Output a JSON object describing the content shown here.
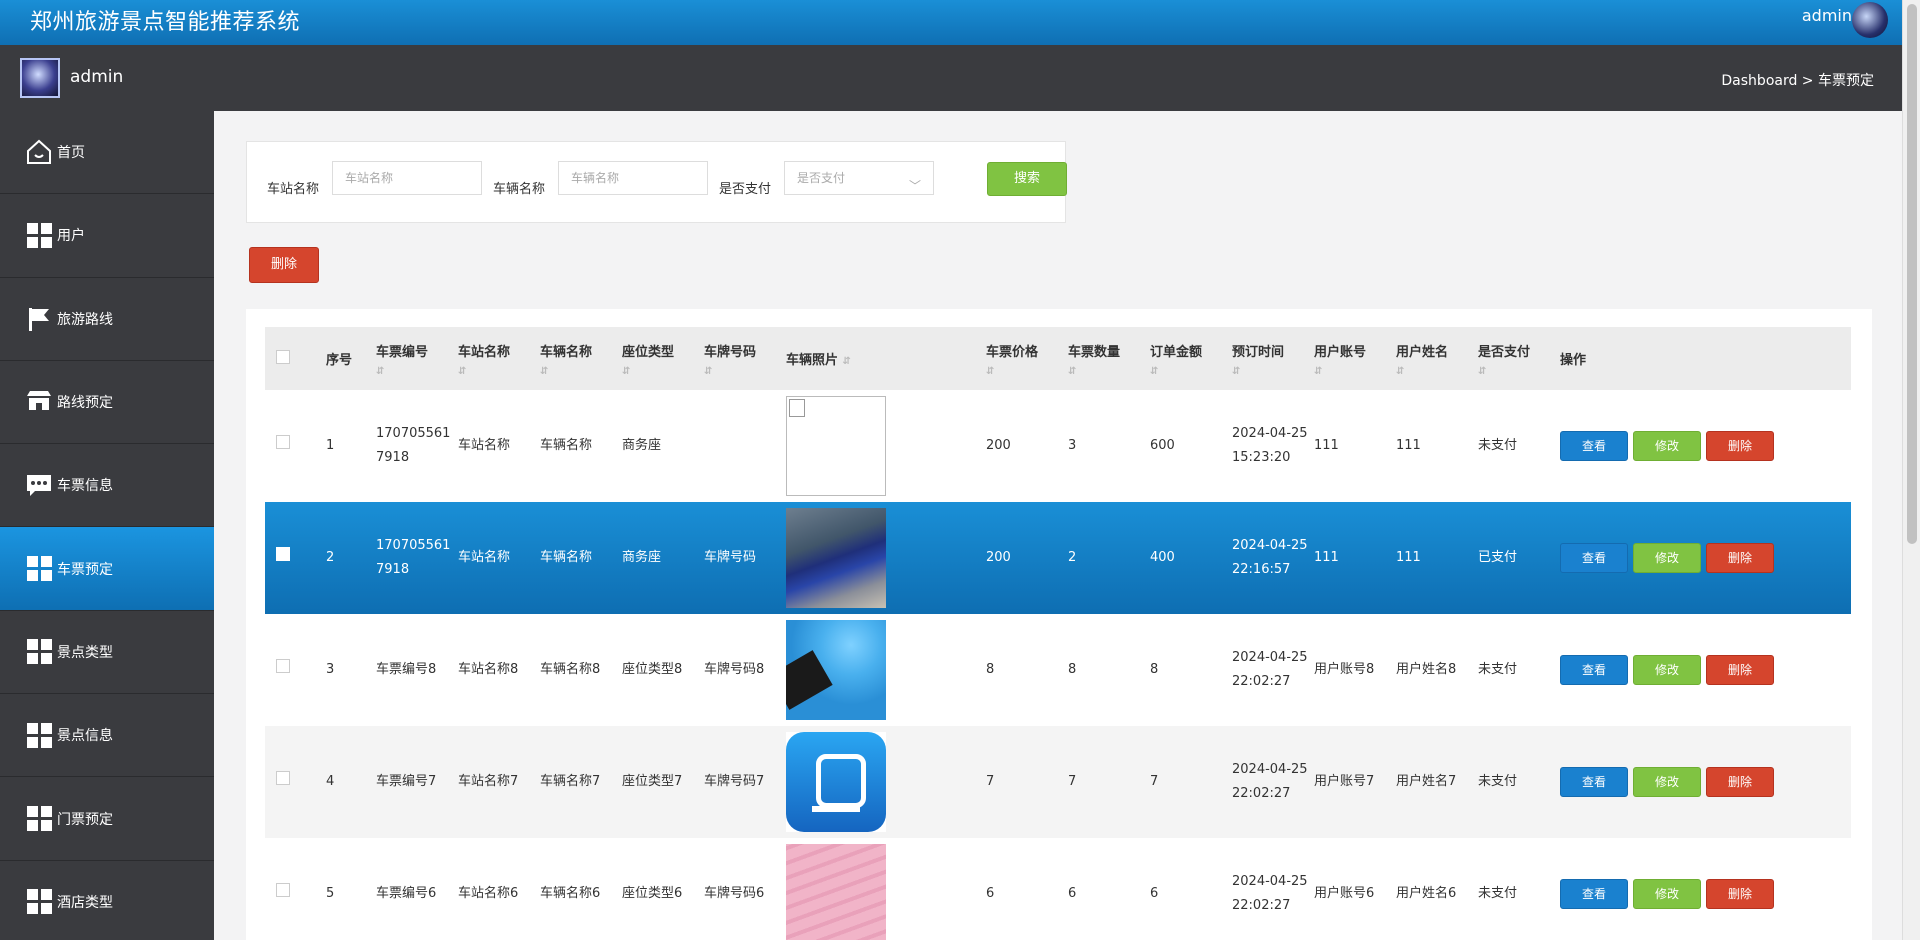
{
  "header": {
    "title": "郑州旅游景点智能推荐系统",
    "user": "admin"
  },
  "subbar": {
    "name": "admin",
    "breadcrumb": "Dashboard > 车票预定"
  },
  "sidebar": {
    "items": [
      {
        "label": "首页",
        "icon": "home-icon"
      },
      {
        "label": "用户",
        "icon": "grid-icon"
      },
      {
        "label": "旅游路线",
        "icon": "flag-icon"
      },
      {
        "label": "路线预定",
        "icon": "shop-icon"
      },
      {
        "label": "车票信息",
        "icon": "chat-icon"
      },
      {
        "label": "车票预定",
        "icon": "grid-icon",
        "active": true
      },
      {
        "label": "景点类型",
        "icon": "grid-icon"
      },
      {
        "label": "景点信息",
        "icon": "grid-icon"
      },
      {
        "label": "门票预定",
        "icon": "grid-icon"
      },
      {
        "label": "酒店类型",
        "icon": "grid-icon"
      }
    ]
  },
  "search": {
    "station_label": "车站名称",
    "station_placeholder": "车站名称",
    "vehicle_label": "车辆名称",
    "vehicle_placeholder": "车辆名称",
    "paid_label": "是否支付",
    "paid_placeholder": "是否支付",
    "search_button": "搜索"
  },
  "toolbar": {
    "delete_label": "删除"
  },
  "table": {
    "headers": [
      "序号",
      "车票编号",
      "车站名称",
      "车辆名称",
      "座位类型",
      "车牌号码",
      "车辆照片",
      "车票价格",
      "车票数量",
      "订单金额",
      "预订时间",
      "用户账号",
      "用户姓名",
      "是否支付",
      "操作"
    ],
    "rows": [
      {
        "no": "1",
        "ticket_no": "1707055617918",
        "station": "车站名称",
        "vehicle": "车辆名称",
        "seat": "商务座",
        "plate": "",
        "photo": "blank",
        "price": "200",
        "qty": "3",
        "amount": "600",
        "time": "2024-04-25 15:23:20",
        "account": "111",
        "username": "111",
        "paid": "未支付"
      },
      {
        "no": "2",
        "ticket_no": "1707055617918",
        "station": "车站名称",
        "vehicle": "车辆名称",
        "seat": "商务座",
        "plate": "车牌号码",
        "photo": "car",
        "price": "200",
        "qty": "2",
        "amount": "400",
        "time": "2024-04-25 22:16:57",
        "account": "111",
        "username": "111",
        "paid": "已支付"
      },
      {
        "no": "3",
        "ticket_no": "车票编号8",
        "station": "车站名称8",
        "vehicle": "车辆名称8",
        "seat": "座位类型8",
        "plate": "车牌号码8",
        "photo": "wait",
        "price": "8",
        "qty": "8",
        "amount": "8",
        "time": "2024-04-25 22:02:27",
        "account": "用户账号8",
        "username": "用户姓名8",
        "paid": "未支付"
      },
      {
        "no": "4",
        "ticket_no": "车票编号7",
        "station": "车站名称7",
        "vehicle": "车辆名称7",
        "seat": "座位类型7",
        "plate": "车牌号码7",
        "photo": "train",
        "price": "7",
        "qty": "7",
        "amount": "7",
        "time": "2024-04-25 22:02:27",
        "account": "用户账号7",
        "username": "用户姓名7",
        "paid": "未支付"
      },
      {
        "no": "5",
        "ticket_no": "车票编号6",
        "station": "车站名称6",
        "vehicle": "车辆名称6",
        "seat": "座位类型6",
        "plate": "车牌号码6",
        "photo": "tickets",
        "price": "6",
        "qty": "6",
        "amount": "6",
        "time": "2024-04-25 22:02:27",
        "account": "用户账号6",
        "username": "用户姓名6",
        "paid": "未支付"
      }
    ],
    "actions": {
      "view": "查看",
      "edit": "修改",
      "delete": "删除"
    }
  },
  "colors": {
    "primary": "#1a81cf",
    "success": "#80c342",
    "danger": "#d5452d",
    "sidebar": "#3a3b3f"
  }
}
